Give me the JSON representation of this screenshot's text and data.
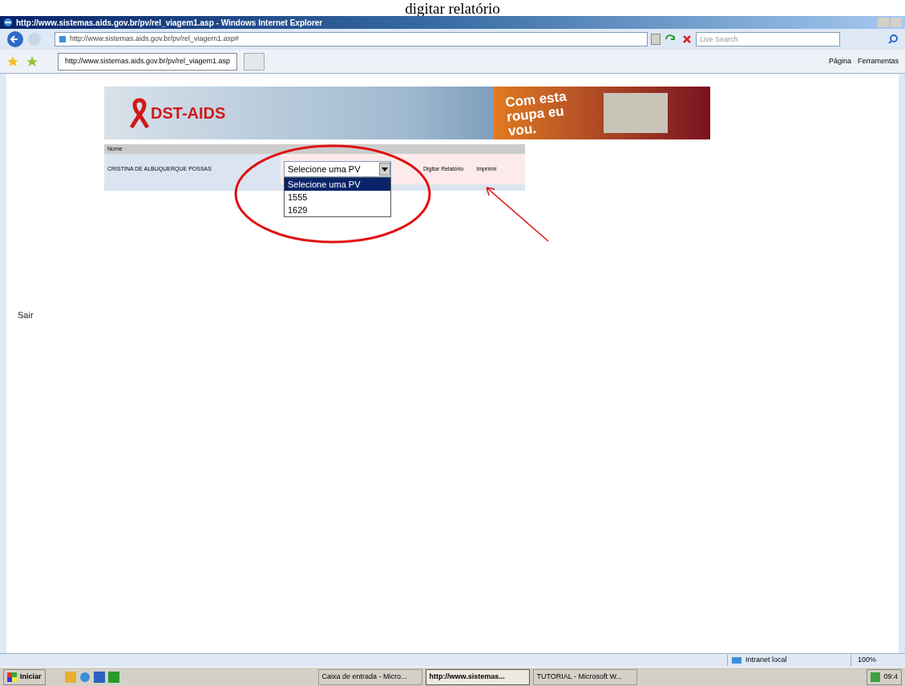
{
  "caption": "digitar relatório",
  "window": {
    "title": "http://www.sistemas.aids.gov.br/pv/rel_viagem1.asp - Windows Internet Explorer"
  },
  "address_bar": {
    "value": "http://www.sistemas.aids.gov.br/pv/rel_viagem1.asp#"
  },
  "search": {
    "placeholder": "Live Search"
  },
  "tabs": [
    {
      "label": "http://www.sistemas.aids.gov.br/pv/rel_viagem1.asp",
      "selected": true
    }
  ],
  "command_bar": [
    "Página",
    "Ferramentas"
  ],
  "banner": {
    "logo": "DST-AIDS",
    "slogan": "Com esta roupa eu vou."
  },
  "table": {
    "header": "Nome",
    "name": "CRISTINA DE ALBUQUERQUE POSSAS",
    "select_value": "Selecione uma PV",
    "options": [
      {
        "label": "Selecione uma PV",
        "selected": true
      },
      {
        "label": "1555",
        "selected": false
      },
      {
        "label": "1629",
        "selected": false
      }
    ],
    "links": [
      "Digitar Relatório",
      "Imprimir"
    ]
  },
  "exit_link": "Sair",
  "status_bar": {
    "zone": "Intranet local",
    "zoom": "100%"
  },
  "taskbar": {
    "start": "Iniciar",
    "tasks": [
      {
        "label": "Caixa de entrada - Micro...",
        "selected": false
      },
      {
        "label": "http://www.sistemas...",
        "selected": true
      },
      {
        "label": "TUTORIAL - Microsoft W...",
        "selected": false
      }
    ],
    "clock": "09:4"
  }
}
